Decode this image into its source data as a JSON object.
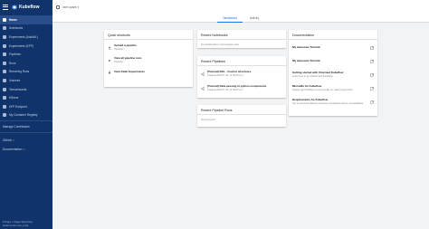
{
  "sidebar": {
    "brand": "Kubeflow",
    "items": [
      {
        "label": "Home",
        "active": true
      },
      {
        "label": "Notebooks"
      },
      {
        "label": "Experiments (AutoML)"
      },
      {
        "label": "Experiments (KFP)"
      },
      {
        "label": "Pipelines"
      },
      {
        "label": "Runs"
      },
      {
        "label": "Recurring Runs"
      },
      {
        "label": "Volumes"
      },
      {
        "label": "Tensorboards"
      },
      {
        "label": "KServe"
      },
      {
        "label": "KFP Endpoint"
      },
      {
        "label": "My Container Registry"
      }
    ],
    "manage_contributors": "Manage Contributors",
    "github": "GitHub",
    "documentation": "Documentation",
    "footer_links": "Privacy • Usage Reporting",
    "build": "build version dev_local"
  },
  "topbar": {
    "namespace": "user-space"
  },
  "tabs": [
    {
      "label": "Dashboard",
      "active": true
    },
    {
      "label": "Activity"
    }
  ],
  "quick_shortcuts": {
    "title": "Quick shortcuts",
    "items": [
      {
        "title": "Upload a pipeline",
        "subtitle": "Pipelines"
      },
      {
        "title": "View all pipeline runs",
        "subtitle": "Pipelines"
      },
      {
        "title": "View Katib Experiments",
        "subtitle": ""
      }
    ]
  },
  "recent_notebooks": {
    "title": "Recent Notebooks",
    "empty": "No Notebooks in namespace user"
  },
  "recent_pipelines": {
    "title": "Recent Pipelines",
    "items": [
      {
        "title": "[Tutorial] DSL - Control structures",
        "subtitle": "Created 2023-07-10, 11:45:06 a.m."
      },
      {
        "title": "[Tutorial] Data passing in python components",
        "subtitle": "Created 2023-07-10, 11:45:05 a.m."
      }
    ]
  },
  "recent_runs": {
    "title": "Recent Pipeline Runs",
    "empty": "None Found"
  },
  "documentation": {
    "title": "Documentation",
    "items": [
      {
        "title": "My Awesome Tutorial",
        "subtitle": ""
      },
      {
        "title": "My Awesome Tutorial",
        "subtitle": ""
      },
      {
        "title": "Getting started with Charmed Kubeflow",
        "subtitle": "Learn how to get started with Kubeflow"
      },
      {
        "title": "Microk8s for Kubeflow",
        "subtitle": "Quickly get Kubeflow running locally on native hypervisors"
      },
      {
        "title": "Requirements for Kubeflow",
        "subtitle": "Get to know the different versions of Kubeflow and its compatibilities"
      }
    ]
  },
  "colors": {
    "sidebar_bg": "#10336b",
    "accent": "#1a73e8",
    "page_bg": "#f1f3f4"
  }
}
